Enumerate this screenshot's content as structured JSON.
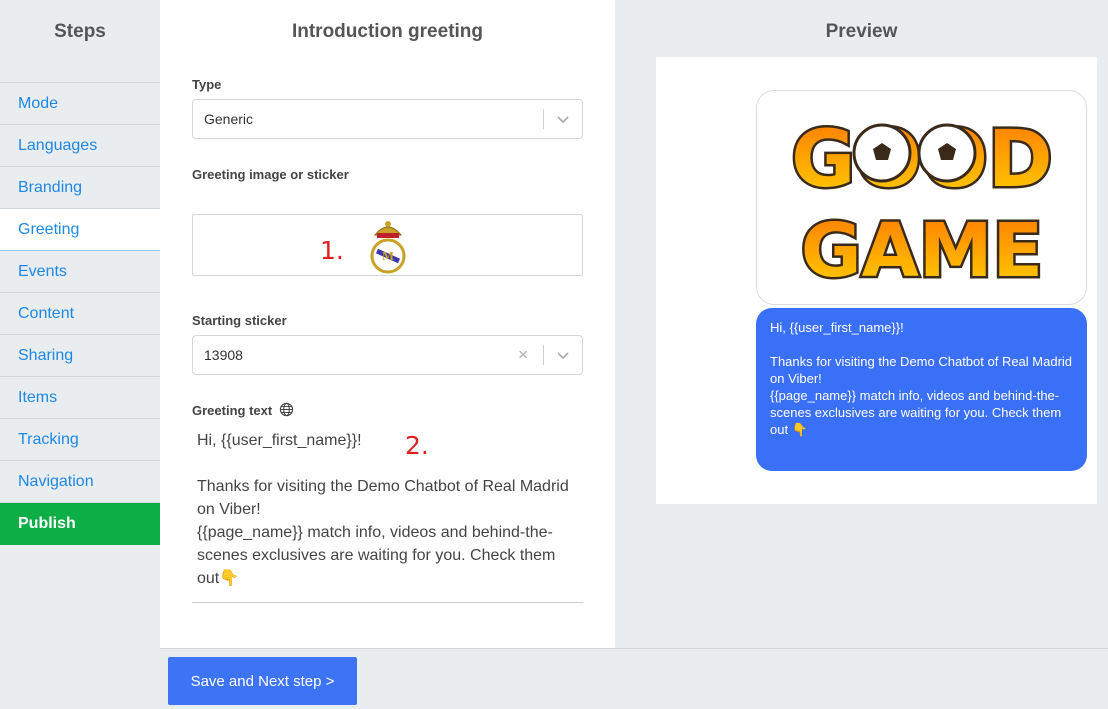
{
  "sidebar": {
    "title": "Steps",
    "items": [
      {
        "label": "Mode"
      },
      {
        "label": "Languages"
      },
      {
        "label": "Branding"
      },
      {
        "label": "Greeting"
      },
      {
        "label": "Events"
      },
      {
        "label": "Content"
      },
      {
        "label": "Sharing"
      },
      {
        "label": "Items"
      },
      {
        "label": "Tracking"
      },
      {
        "label": "Navigation"
      },
      {
        "label": "Publish"
      }
    ]
  },
  "main": {
    "title": "Introduction greeting",
    "type_label": "Type",
    "type_value": "Generic",
    "image_label": "Greeting image or sticker",
    "starting_sticker_label": "Starting sticker",
    "starting_sticker_value": "13908",
    "greeting_text_label": "Greeting text",
    "greeting_text": "Hi, {{user_first_name}}!\n\nThanks for visiting the Demo Chatbot of Real Madrid on Viber!\n{{page_name}} match info, videos and behind-the-scenes exclusives are waiting for you. Check them out👇",
    "marker_1": "1.",
    "marker_2": "2."
  },
  "preview": {
    "title": "Preview",
    "sticker_word_1": "GOOD",
    "sticker_word_2": "GAME",
    "bubble_text": "Hi, {{user_first_name}}!\n\nThanks for visiting the Demo Chatbot of Real Madrid on Viber!\n{{page_name}} match info, videos and behind-the-scenes exclusives are waiting for you. Check them out 👇"
  },
  "footer": {
    "save_label": "Save and Next step >"
  },
  "colors": {
    "accent": "#1e88e5",
    "publish": "#0eae47",
    "bubble": "#3a6ff7",
    "marker": "#e02020"
  },
  "icons": {
    "chevron": "chevron-down-icon",
    "clear": "clear-icon",
    "globe": "globe-icon",
    "crest": "real-madrid-crest-icon"
  }
}
